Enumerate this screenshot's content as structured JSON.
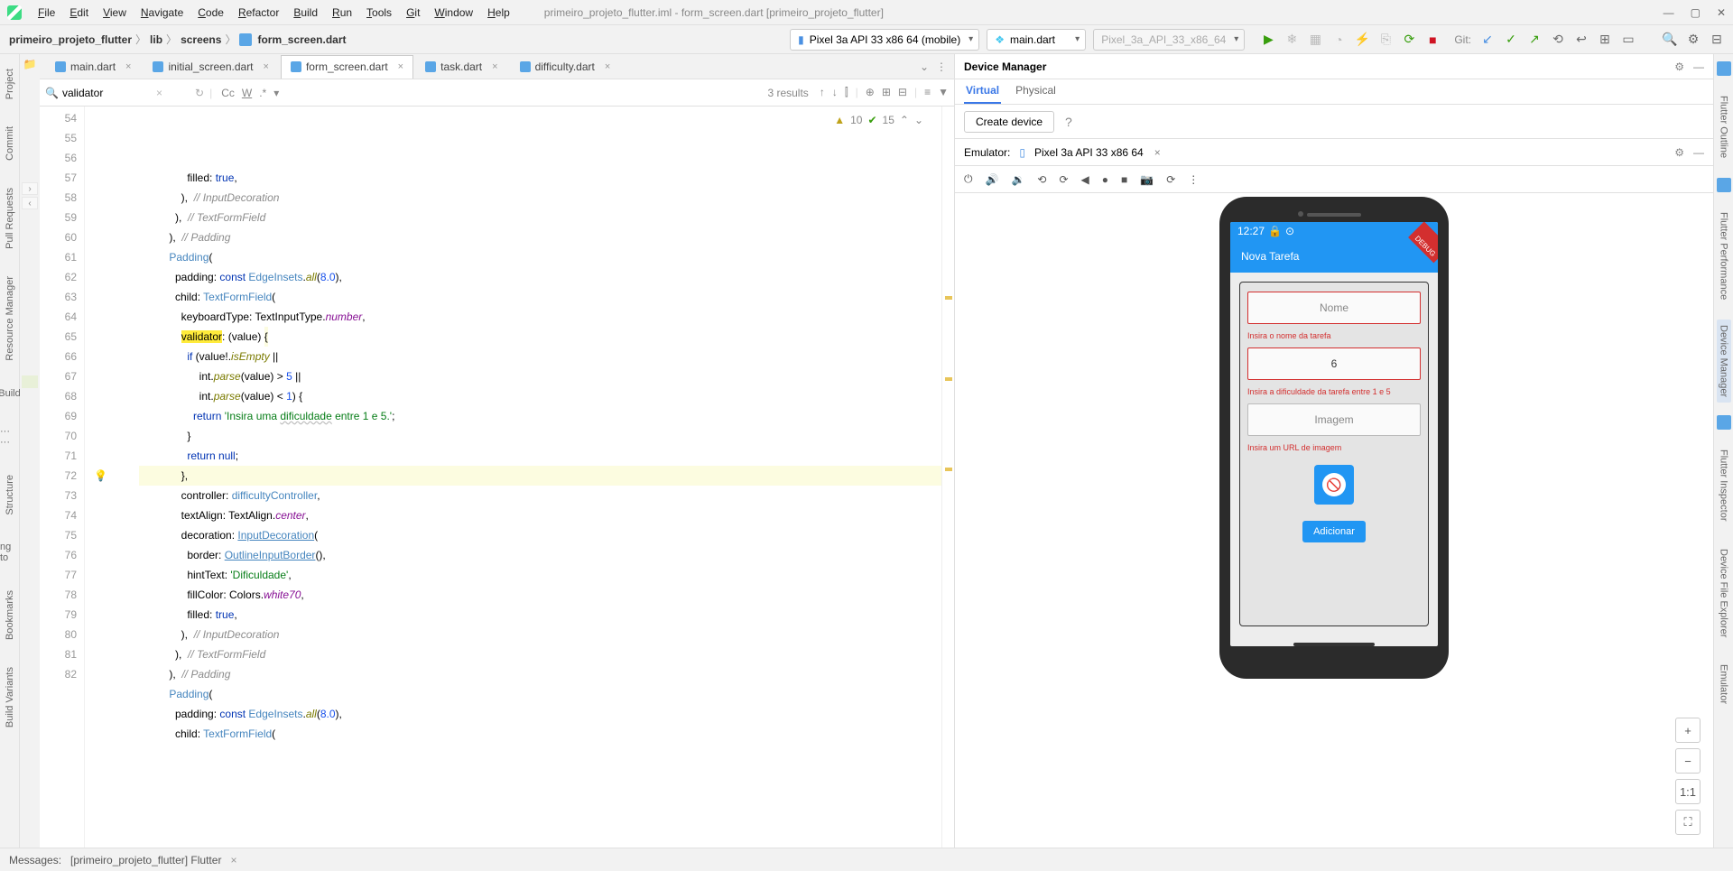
{
  "menu": {
    "items": [
      "File",
      "Edit",
      "View",
      "Navigate",
      "Code",
      "Refactor",
      "Build",
      "Run",
      "Tools",
      "Git",
      "Window",
      "Help"
    ],
    "title": "primeiro_projeto_flutter.iml - form_screen.dart [primeiro_projeto_flutter]"
  },
  "breadcrumb": {
    "project": "primeiro_projeto_flutter",
    "p1": "lib",
    "p2": "screens",
    "file": "form_screen.dart"
  },
  "devices": {
    "target": "Pixel 3a API 33 x86 64 (mobile)",
    "config": "main.dart",
    "avd": "Pixel_3a_API_33_x86_64"
  },
  "git_label": "Git:",
  "editor": {
    "tabs": [
      {
        "label": "main.dart",
        "active": false,
        "close": true
      },
      {
        "label": "initial_screen.dart",
        "active": false,
        "close": true
      },
      {
        "label": "form_screen.dart",
        "active": true,
        "close": true
      },
      {
        "label": "task.dart",
        "active": false,
        "close": true
      },
      {
        "label": "difficulty.dart",
        "active": false,
        "close": true
      }
    ],
    "search": {
      "query": "validator",
      "results": "3 results"
    },
    "hints": {
      "warn": "10",
      "ok": "15"
    },
    "lines": {
      "start": 54,
      "rows": [
        {
          "n": 54,
          "html": "                filled: <span class='kw'>true</span>,"
        },
        {
          "n": 55,
          "html": "              ),  <span class='cmt'>// InputDecoration</span>"
        },
        {
          "n": 56,
          "html": "            ),  <span class='cmt'>// TextFormField</span>"
        },
        {
          "n": 57,
          "html": "          ),  <span class='cmt'>// Padding</span>"
        },
        {
          "n": 58,
          "html": "          <span class='blue'>Padding</span>("
        },
        {
          "n": 59,
          "html": "            padding: <span class='kw'>const</span> <span class='blue'>EdgeInsets</span>.<span class='fn'>all</span>(<span class='num'>8.0</span>),"
        },
        {
          "n": 60,
          "html": "            child: <span class='blue'>TextFormField</span>("
        },
        {
          "n": 61,
          "html": "              keyboardType: TextInputType.<span class='prop'>number</span>,"
        },
        {
          "n": 62,
          "html": "              <span class='yel'>validator</span>: (value) <span class='hl'>{</span>"
        },
        {
          "n": 63,
          "html": "                <span class='kw'>if</span> (value!.<span class='fn'>isEmpty</span> ||"
        },
        {
          "n": 64,
          "html": "                    int.<span class='fn'>parse</span>(value) &gt; <span class='num'>5</span> ||"
        },
        {
          "n": 65,
          "html": "                    int.<span class='fn'>parse</span>(value) &lt; <span class='num'>1</span>) {"
        },
        {
          "n": 66,
          "html": "                  <span class='kw'>return</span> <span class='str'>'Insira uma <span class='und'>dificuldade</span> entre 1 e 5.'</span>;"
        },
        {
          "n": 67,
          "html": "                }"
        },
        {
          "n": 68,
          "html": "                <span class='kw'>return null</span>;"
        },
        {
          "n": 69,
          "html": "              <span class='hl'>}</span>,",
          "bulb": true
        },
        {
          "n": 70,
          "html": "              controller: <span class='blue'>difficultyController</span>,"
        },
        {
          "n": 71,
          "html": "              textAlign: TextAlign.<span class='prop'>center</span>,"
        },
        {
          "n": 72,
          "html": "              decoration: <span class='blue' style='text-decoration:underline'>InputDecoration</span>("
        },
        {
          "n": 73,
          "html": "                border: <span class='blue' style='text-decoration:underline'>OutlineInputBorder</span>(),"
        },
        {
          "n": 74,
          "html": "                hintText: <span class='str'>'Dificuldade'</span>,"
        },
        {
          "n": 75,
          "html": "                fillColor: Colors.<span class='prop'>white70</span>,"
        },
        {
          "n": 76,
          "html": "                filled: <span class='kw'>true</span>,"
        },
        {
          "n": 77,
          "html": "              ),  <span class='cmt'>// InputDecoration</span>"
        },
        {
          "n": 78,
          "html": "            ),  <span class='cmt'>// TextFormField</span>"
        },
        {
          "n": 79,
          "html": "          ),  <span class='cmt'>// Padding</span>"
        },
        {
          "n": 80,
          "html": "          <span class='blue'>Padding</span>("
        },
        {
          "n": 81,
          "html": "            padding: <span class='kw'>const</span> <span class='blue'>EdgeInsets</span>.<span class='fn'>all</span>(<span class='num'>8.0</span>),"
        },
        {
          "n": 82,
          "html": "            child: <span class='blue'>TextFormField</span>("
        }
      ]
    }
  },
  "dm": {
    "title": "Device Manager",
    "tabs": {
      "virtual": "Virtual",
      "physical": "Physical"
    },
    "create": "Create device",
    "help": "?",
    "emulator_label": "Emulator:",
    "emulator_name": "Pixel 3a API 33 x86 64"
  },
  "left_tools": {
    "project": "Project",
    "commit": "Commit",
    "pull": "Pull Requests",
    "res": "Resource Manager",
    "build": "Build",
    "struct": "Structure",
    "book": "Bookmarks",
    "variants": "Build Variants",
    "dots": "···  ···",
    "ng": "ng to"
  },
  "right_tools": {
    "outline": "Flutter Outline",
    "perf": "Flutter Performance",
    "devmgr": "Device Manager",
    "inspector": "Flutter Inspector",
    "explorer": "Device File Explorer",
    "emul": "Emulator"
  },
  "app": {
    "time": "12:27",
    "title": "Nova Tarefa",
    "hint_name": "Nome",
    "err_name": "Insira o nome da tarefa",
    "val_diff": "6",
    "err_diff": "Insira a dificuldade da tarefa entre 1 e 5",
    "hint_img": "Imagem",
    "err_img": "Insira um URL de imagem",
    "add": "Adicionar"
  },
  "zoom": {
    "plus": "+",
    "minus": "−",
    "one": "1:1",
    "fit": "⛶"
  },
  "status": {
    "label": "Messages:",
    "text": "[primeiro_projeto_flutter] Flutter"
  }
}
